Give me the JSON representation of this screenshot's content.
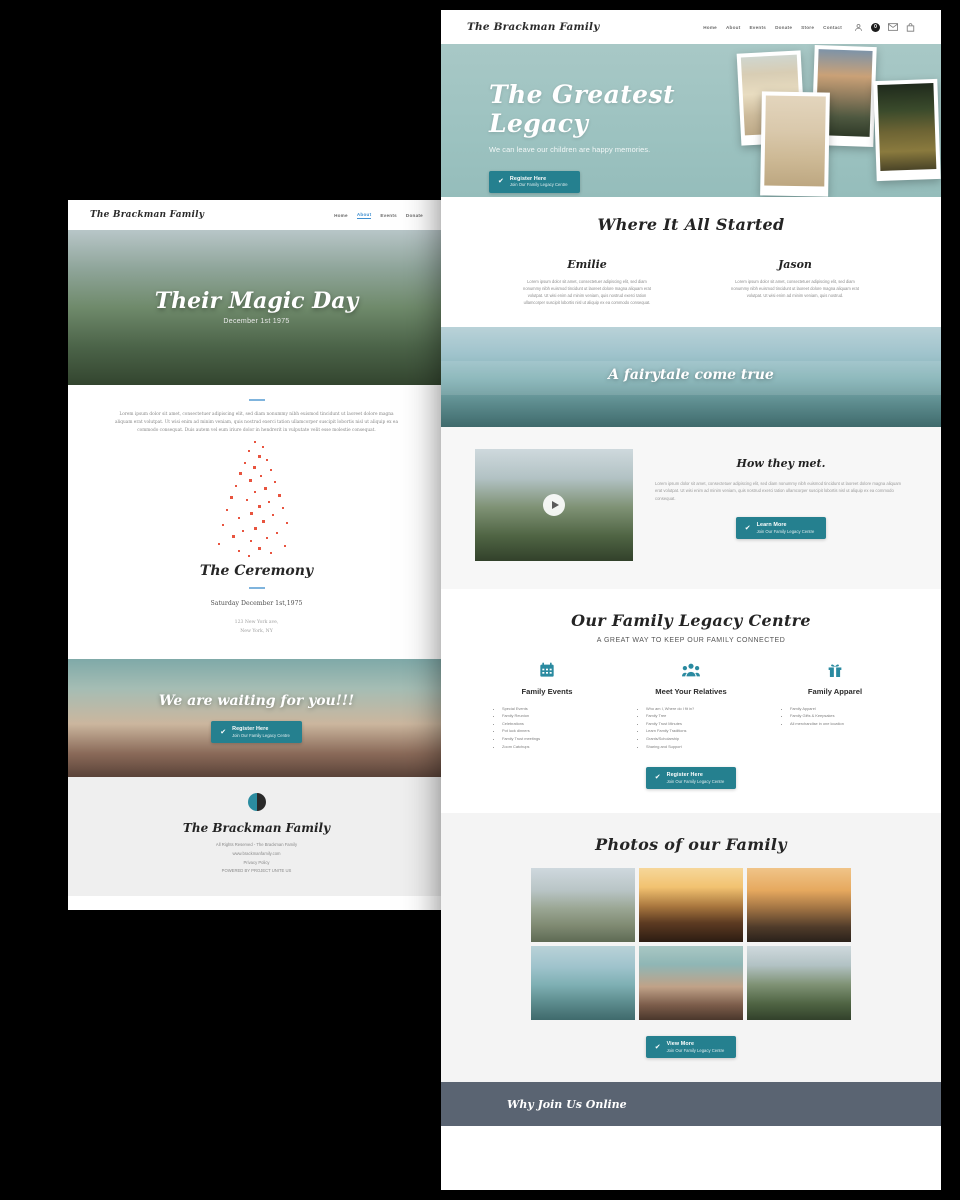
{
  "brand": {
    "name": "The Brackman Family"
  },
  "front_window": {
    "nav": {
      "items": [
        "Home",
        "About",
        "Events",
        "Donate",
        "Store",
        "Contact"
      ],
      "icons": [
        "user-icon",
        "notification-icon",
        "mail-icon",
        "bag-icon"
      ],
      "notification_badge": "0"
    },
    "hero": {
      "title": "The Greatest Legacy",
      "subtitle": "We can leave our children are happy memories.",
      "cta": {
        "line1": "Register Here",
        "line2": "Join Our Family Legacy Centre",
        "icon": "check-icon"
      }
    },
    "started": {
      "title": "Where It All Started",
      "people": [
        {
          "name": "Emilie",
          "photo": "woman-in-sunset-field",
          "text": "Lorem ipsum dolor sit amet, consectetuer adipiscing elit, sed diam nonummy nibh euismod tincidunt ut laoreet dolore magna aliquam erat volutpat. Ut wisi enim ad minim veniam, quis nostrud exerci tation ullamcorper suscipit lobortis nisl ut aliquip ex ea commodo consequat."
        },
        {
          "name": "Jason",
          "photo": "man-overlooking-city",
          "text": "Lorem ipsum dolor sit amet, consectetuer adipiscing elit, sed diam nonummy nibh euismod tincidunt ut laoreet dolore magna aliquam erat volutpat. Ut wisi enim ad minim veniam, quis nostrud."
        }
      ]
    },
    "fairytale_banner": {
      "text": "A fairytale come true",
      "photo": "couple-with-bicycles-on-beach"
    },
    "how_they_met": {
      "title": "How they met.",
      "video_photo": "couple-on-bench-mountains",
      "play_icon": "play-icon",
      "text": "Lorem ipsum dolor sit amet, consectetuer adipiscing elit, sed diam nonummy nibh euismod tincidunt ut laoreet dolore magna aliquam erat volutpat. Ut wisi enim ad minim veniam, quis nostrud exerci tation ullamcorper suscipit lobortis nisl ut aliquip ex ea commodo consequat.",
      "cta": {
        "line1": "Learn More",
        "line2": "Join Our Family Legacy Centre",
        "icon": "check-icon"
      }
    },
    "legacy_centre": {
      "title": "Our Family Legacy Centre",
      "subtitle": "A GREAT WAY TO KEEP OUR FAMILY CONNECTED",
      "features": [
        {
          "icon": "calendar-icon",
          "title": "Family Events",
          "items": [
            "Special Events",
            "Family Reunion",
            "Celebrations",
            "Pot luck dinners",
            "Family Trust meetings",
            "Zoom Catchups"
          ]
        },
        {
          "icon": "people-icon",
          "title": "Meet Your Relatives",
          "items": [
            "Who am I, Where do I fit in?",
            "Family Tree",
            "Family Trust Minutes",
            "Learn Family Traditions",
            "Grants/Scholarship",
            "Sharing and Support"
          ]
        },
        {
          "icon": "gift-icon",
          "title": "Family Apparel",
          "items": [
            "Family Apparel",
            "Family Gifts & Keepsakes",
            "All merchandise in one location"
          ]
        }
      ],
      "cta": {
        "line1": "Register Here",
        "line2": "Join Our Family Legacy Centre",
        "icon": "check-icon"
      }
    },
    "photos": {
      "title": "Photos of our Family",
      "items": [
        "man-overlooking-city",
        "woman-in-sunset-field",
        "couple-at-sunset-dock",
        "couple-bicycles-beach",
        "hands-reaching-over-rocks",
        "couple-on-bench-mountains"
      ],
      "cta": {
        "line1": "View More",
        "line2": "Join Our Family Legacy Centre",
        "icon": "check-icon"
      }
    },
    "bottom_bar": {
      "text": "Why Join Us Online"
    }
  },
  "back_window": {
    "nav": {
      "items": [
        "Home",
        "About",
        "Events",
        "Donate"
      ],
      "active": "About"
    },
    "hero": {
      "title": "Their Magic Day",
      "date": "December 1st 1975",
      "photo": "couple-on-bench-mountains"
    },
    "intro": "Lorem ipsum dolor sit amet, consectetuer adipiscing elit, sed diam nonummy nibh euismod tincidunt ut laoreet dolore magna aliquam erat volutpat. Ut wisi enim ad minim veniam, quis nostrud exerci tation ullamcorper suscipit lobortis nisl ut aliquip ex ea commodo consequat. Duis autem vel eum iriure dolor in hendrerit in vulputate velit esse molestie consequat.",
    "ceremony": {
      "title": "The Ceremony",
      "date": "Saturday December 1st,1975",
      "address_line1": "123 New York ave,",
      "address_line2": "New York, NY"
    },
    "waiting": {
      "text": "We are waiting for you!!!",
      "photo": "hand-with-ring-over-water",
      "cta": {
        "line1": "Register Here",
        "line2": "Join Our Family Legacy Centre",
        "icon": "check-icon"
      }
    },
    "footer": {
      "logo": "family-logo-icon",
      "title": "The Brackman Family",
      "lines": [
        "All Rights Reserved - The Brackman Family",
        "www.brackmanfamily.com",
        "Privacy Policy",
        "POWERED BY PROJECT UNITE US"
      ]
    }
  },
  "colors": {
    "accent": "#25808f",
    "hero_bg": "#9cc2c0",
    "footer_bar": "#5a6472",
    "link_active": "#3f8fd0"
  }
}
